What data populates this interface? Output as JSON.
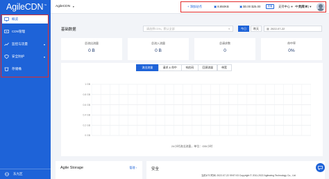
{
  "app": {
    "logo_text": "AgileCDN",
    "logo_mark": "™",
    "accent_color": "#1e63d8",
    "highlight_color": "#e22a2a"
  },
  "sidebar": {
    "items": [
      {
        "label": "概览",
        "icon": "monitor-icon",
        "active": true
      },
      {
        "label": "CDN管理",
        "icon": "cloud-icon",
        "active": false
      },
      {
        "label": "监控与流量",
        "icon": "chart-icon",
        "active": false,
        "has_children": true
      },
      {
        "label": "安全防护",
        "icon": "shield-icon",
        "active": false,
        "has_children": true
      },
      {
        "label": "存储桶",
        "icon": "bucket-icon",
        "active": false
      }
    ],
    "footer_label": "东九区"
  },
  "topbar": {
    "project": "AgileCDN",
    "add_site": "+ 添加站点",
    "traffic": "8.850KB",
    "balance": "$0.00 $25.00",
    "recharge": "充值",
    "support": "支持中心",
    "billing": "费用",
    "language": "中文(简体)"
  },
  "main": {
    "section_title": "基础数据",
    "select_placeholder": "请选择CDN，默认全部",
    "today": "今日",
    "yesterday": "昨天",
    "date": "2022-07-22",
    "stats": [
      {
        "label": "总流出流量",
        "value": "0 B"
      },
      {
        "label": "总流入流量",
        "value": "0 B"
      },
      {
        "label": "总请求数",
        "value": "0"
      },
      {
        "label": "命中率",
        "value": "0%"
      }
    ],
    "tabs": [
      "流出流量",
      "请求 & 命中",
      "响应码",
      "回源流量",
      "带宽"
    ],
    "active_tab": 0,
    "chart_caption": "24小时流出流量，单位：GB/小时"
  },
  "chart_data": {
    "type": "line",
    "y_ticks": [
      "1 GB",
      "0.8 GB",
      "0.6 GB",
      "0.4 GB",
      "0.2 GB",
      "0 GB"
    ],
    "ylim": [
      0,
      1
    ],
    "grid": true,
    "series": []
  },
  "cards": [
    {
      "title": "Agile Storage",
      "action": "管理 ›"
    },
    {
      "title": "安全"
    }
  ],
  "footer": {
    "text": "当前UTC时间: 2022-07-22 09:57:03     Copyright © 2011-2022 Agilewing Technology Co., Ltd"
  }
}
